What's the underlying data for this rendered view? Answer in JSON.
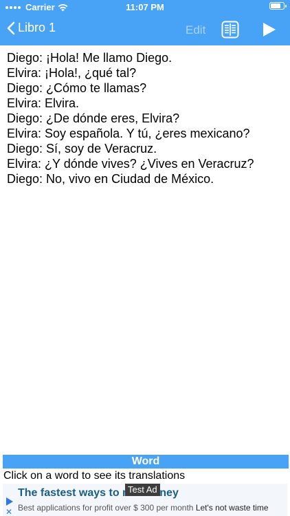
{
  "status": {
    "carrier": "Carrier",
    "time": "11:07 PM",
    "battery_level": 0.9
  },
  "nav": {
    "back_label": "Libro 1",
    "edit_label": "Edit",
    "book_icon": "book-list-icon",
    "play_icon": "play-icon"
  },
  "dialogue": [
    "Diego: ¡Hola! Me llamo Diego.",
    "Elvira: ¡Hola!, ¿qué tal?",
    "Diego: ¿Cómo te llamas?",
    "Elvira: Elvira.",
    "Diego: ¿De dónde eres, Elvira?",
    "Elvira: Soy española. Y tú, ¿eres mexicano?",
    "Diego: Sí, soy de Veracruz.",
    "Elvira: ¿Y dónde vives? ¿Vives en Veracruz?",
    "Diego: No, vivo en Ciudad de México."
  ],
  "word_panel": {
    "title": "Word",
    "hint": "Click on a word to see its translations"
  },
  "ad": {
    "title_start": "The fastest ways to m",
    "title_end": "ney",
    "desc": "Best applications for profit over $ 300 per month",
    "desc_dark": "Let's not waste time",
    "badge": "Test Ad"
  },
  "colors": {
    "accent": "#48a3f6",
    "edit_disabled": "#a9d3fb"
  }
}
